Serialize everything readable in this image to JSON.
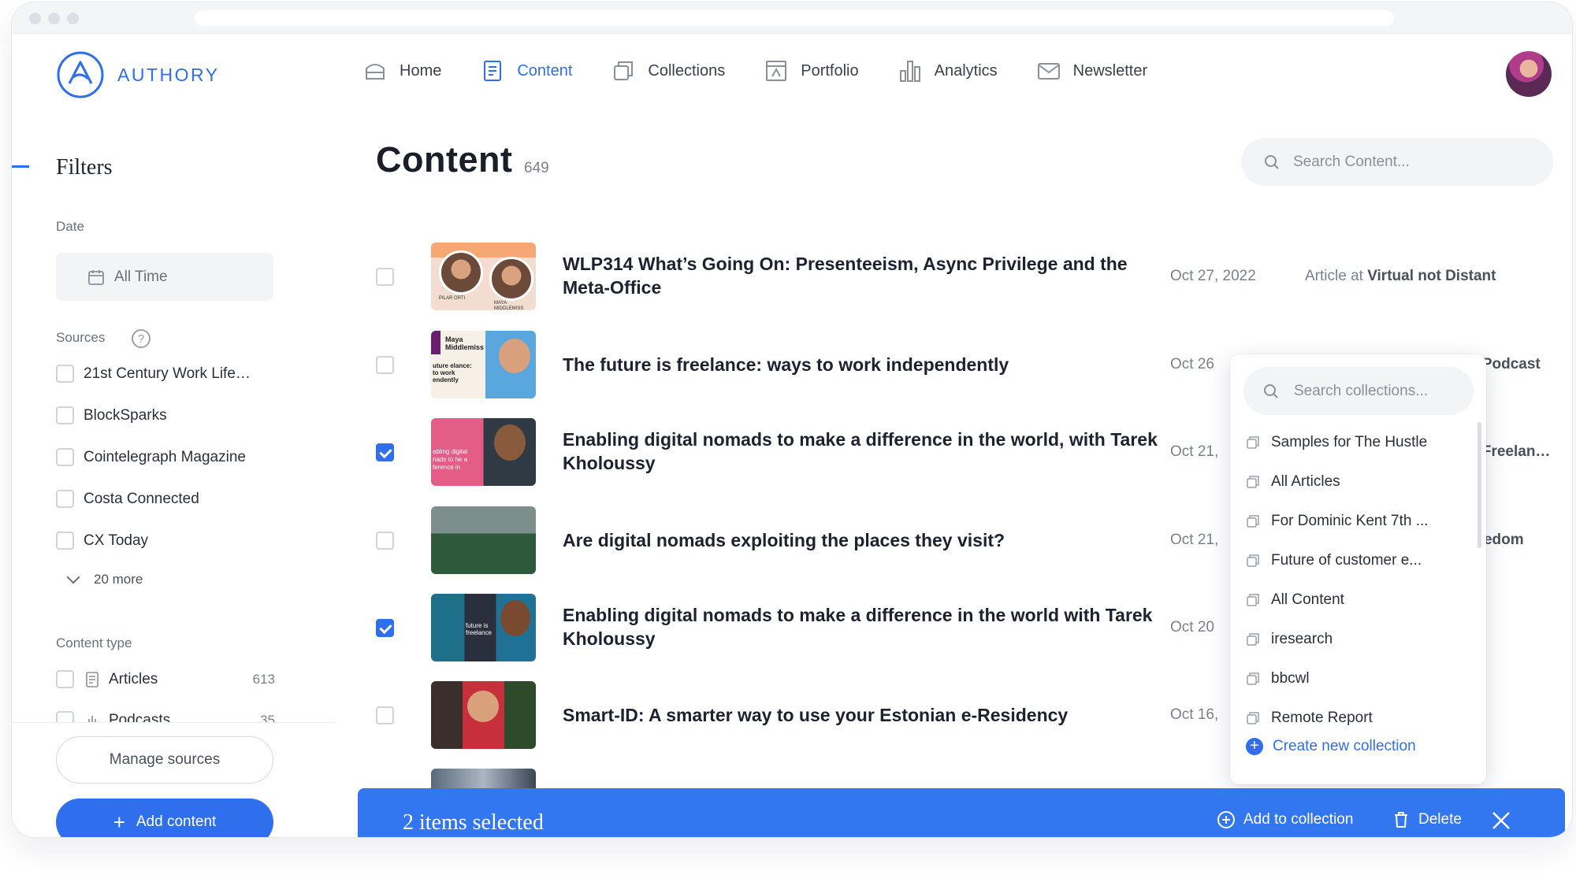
{
  "brand": {
    "name": "AUTHORY",
    "accent": "#2f6fed"
  },
  "nav": {
    "items": [
      {
        "label": "Home",
        "icon": "home-icon",
        "active": false
      },
      {
        "label": "Content",
        "icon": "content-icon",
        "active": true
      },
      {
        "label": "Collections",
        "icon": "collections-icon",
        "active": false
      },
      {
        "label": "Portfolio",
        "icon": "portfolio-icon",
        "active": false
      },
      {
        "label": "Analytics",
        "icon": "analytics-icon",
        "active": false
      },
      {
        "label": "Newsletter",
        "icon": "newsletter-icon",
        "active": false
      }
    ]
  },
  "sidebar": {
    "title": "Filters",
    "date_label": "Date",
    "date_value": "All Time",
    "sources_label": "Sources",
    "sources_help": "?",
    "sources": [
      {
        "label": "21st Century Work Life…",
        "checked": false
      },
      {
        "label": "BlockSparks",
        "checked": false
      },
      {
        "label": "Cointelegraph Magazine",
        "checked": false
      },
      {
        "label": "Costa Connected",
        "checked": false
      },
      {
        "label": "CX Today",
        "checked": false
      }
    ],
    "more_label": "20 more",
    "content_type_label": "Content type",
    "content_types": [
      {
        "label": "Articles",
        "count": "613",
        "icon": "article-icon"
      },
      {
        "label": "Podcasts",
        "count": "35",
        "icon": "podcast-icon"
      }
    ],
    "manage_label": "Manage sources",
    "add_label": "Add content",
    "add_symbol": "+"
  },
  "main": {
    "title": "Content",
    "count": "649",
    "search_placeholder": "Search Content...",
    "rows": [
      {
        "title": "WLP314 What’s Going On: Presenteeism, Async Privilege and the Meta-Office",
        "date": "Oct 27, 2022",
        "source_prefix": "Article at",
        "source": "Virtual not Distant",
        "checked": false
      },
      {
        "title": "The future is freelance: ways to work independently",
        "date": "Oct 26",
        "source_prefix": "",
        "source": "k Podcast",
        "checked": false
      },
      {
        "title": "Enabling digital nomads to make a difference in the world, with Tarek Kholoussy",
        "date": "Oct 21,",
        "source_prefix": "",
        "source": "s Freelan…",
        "checked": true
      },
      {
        "title": "Are digital nomads exploiting the places they visit?",
        "date": "Oct 21,",
        "source_prefix": "",
        "source": "reedom",
        "checked": false
      },
      {
        "title": "Enabling digital nomads to make a difference in the world with Tarek Kholoussy",
        "date": "Oct 20",
        "source_prefix": "",
        "source": "",
        "checked": true
      },
      {
        "title": "Smart-ID: A smarter way to use your Estonian e-Residency",
        "date": "Oct 16,",
        "source_prefix": "",
        "source": "",
        "checked": false
      }
    ],
    "thumb_texts": {
      "t1_left": "PILAR ORTI",
      "t1_right": "MAYA MIDDLEMISS",
      "t2_top": "Maya Middlemiss",
      "t2_bottom": "uture elance: to work endently",
      "t3_text": "abling digital nads to he a ference in",
      "t5_text": "future is freelance"
    }
  },
  "collections_dropdown": {
    "search_placeholder": "Search collections...",
    "items": [
      "Samples for The Hustle",
      "All Articles",
      "For Dominic Kent 7th ...",
      "Future of customer e...",
      "All Content",
      "iresearch",
      "bbcwl",
      "Remote Report"
    ],
    "create_label": "Create new collection",
    "create_symbol": "+"
  },
  "selection_bar": {
    "count_text": "2 items selected",
    "add_label": "Add to collection",
    "delete_label": "Delete",
    "bar_color": "#3377f0"
  }
}
